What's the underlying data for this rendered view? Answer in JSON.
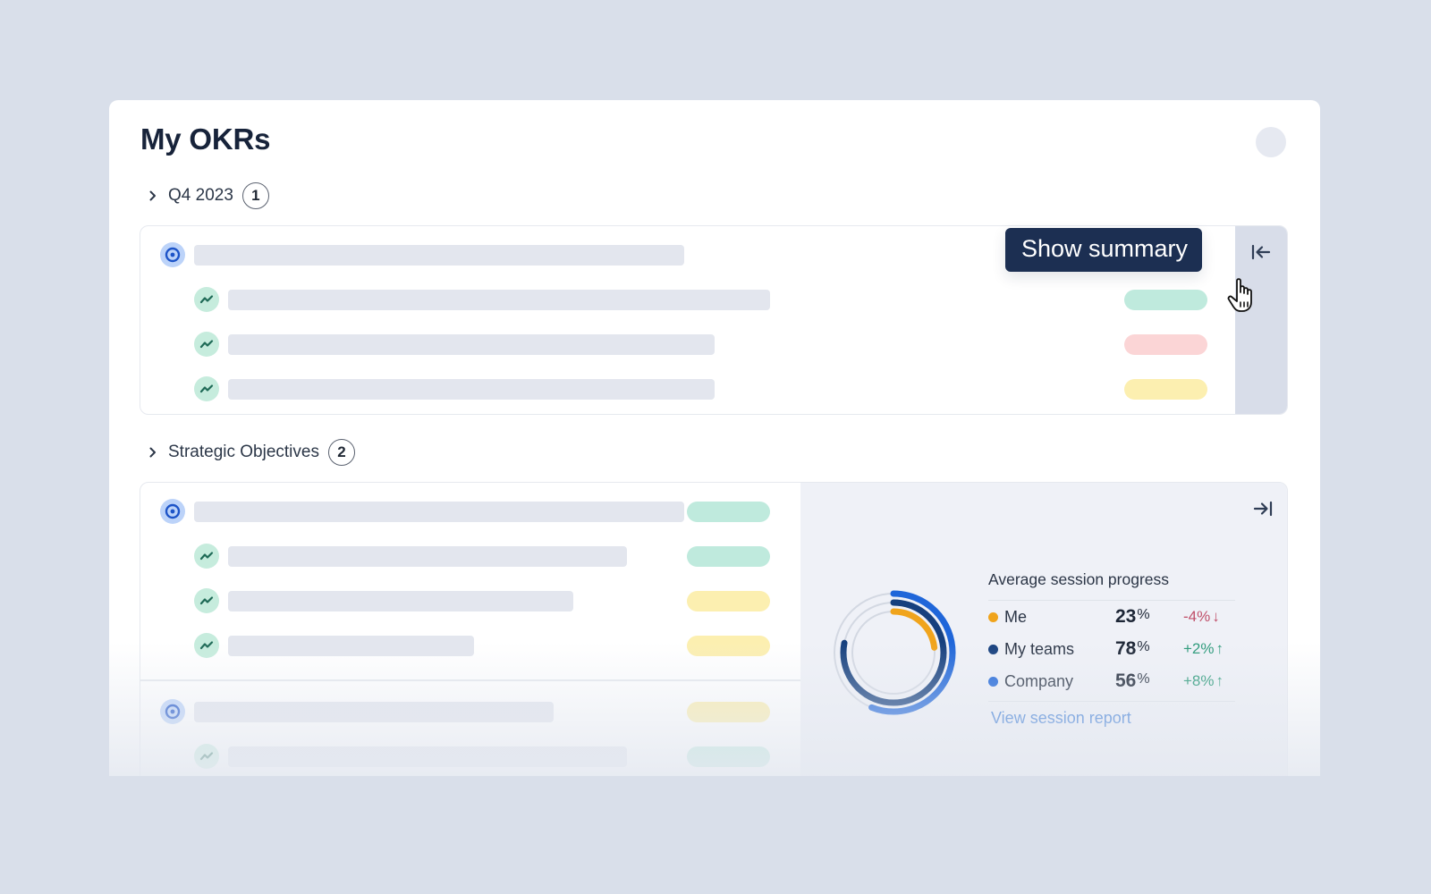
{
  "page": {
    "title": "My OKRs"
  },
  "groups": [
    {
      "name": "Q4 2023",
      "count": "1",
      "summary_collapsed": true,
      "tooltip": "Show summary",
      "objectives": [
        {
          "type": "objective",
          "key_results": [
            {
              "status": "on-track",
              "status_color": "#bfeadd"
            },
            {
              "status": "off-track",
              "status_color": "#fbd5d6"
            },
            {
              "status": "at-risk",
              "status_color": "#fcefb0"
            }
          ]
        }
      ]
    },
    {
      "name": "Strategic Objectives",
      "count": "2",
      "summary_collapsed": false,
      "objectives": [
        {
          "type": "objective",
          "status": "on-track",
          "status_color": "#bfeadd",
          "key_results": [
            {
              "status": "on-track",
              "status_color": "#bfeadd"
            },
            {
              "status": "at-risk",
              "status_color": "#fcefb0"
            },
            {
              "status": "at-risk",
              "status_color": "#fcefb0"
            }
          ]
        },
        {
          "type": "objective",
          "status": "at-risk",
          "status_color": "#fcefb0",
          "key_results": [
            {
              "status": "on-track",
              "status_color": "#bfeadd"
            }
          ]
        }
      ]
    }
  ],
  "summary": {
    "title": "Average session progress",
    "rows": [
      {
        "label": "Me",
        "value": "23",
        "unit": "%",
        "delta": "-4%",
        "direction": "down",
        "color": "#f0a41c"
      },
      {
        "label": "My teams",
        "value": "78",
        "unit": "%",
        "delta": "+2%",
        "direction": "up",
        "color": "#16407e"
      },
      {
        "label": "Company",
        "value": "56",
        "unit": "%",
        "delta": "+8%",
        "direction": "up",
        "color": "#1f66d9"
      }
    ],
    "link": "View session report"
  },
  "icons": {
    "collapse": "arrow-left-to-bar-icon",
    "expand": "arrow-right-to-bar-icon",
    "objective": "target-icon",
    "key_result": "trend-icon",
    "group_toggle": "chevron-right-icon"
  },
  "colors": {
    "accent": "#1f66d9",
    "positive": "#2c9a7a",
    "negative": "#c0506a",
    "tooltip_bg": "#1c2f52"
  }
}
